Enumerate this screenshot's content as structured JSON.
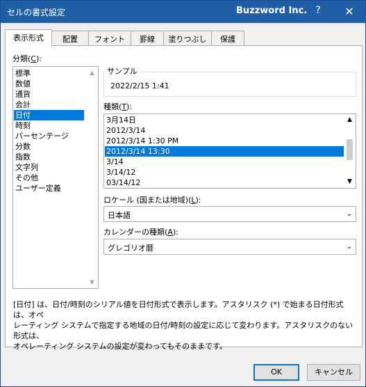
{
  "window": {
    "title": "セルの書式設定",
    "app_name": "Buzzword Inc.",
    "help_label": "?",
    "close_label": "✕"
  },
  "tabs": [
    {
      "label": "表示形式",
      "active": true
    },
    {
      "label": "配置"
    },
    {
      "label": "フォント"
    },
    {
      "label": "罫線"
    },
    {
      "label": "塗りつぶし"
    },
    {
      "label": "保護"
    }
  ],
  "category": {
    "label": "分類(",
    "accesskey": "C",
    "label_end": "):",
    "items": [
      "標準",
      "数値",
      "通貨",
      "会計",
      "日付",
      "時刻",
      "パーセンテージ",
      "分数",
      "指数",
      "文字列",
      "その他",
      "ユーザー定義"
    ],
    "selected_index": 4
  },
  "sample": {
    "title": "サンプル",
    "value": "2022/2/15 1:41"
  },
  "type": {
    "label": "種類(",
    "accesskey": "T",
    "label_end": "):",
    "items": [
      "3月14日",
      "2012/3/14",
      "2012/3/14 1:30 PM",
      "2012/3/14 13:30",
      "3/14",
      "3/14/12",
      "03/14/12"
    ],
    "selected_index": 3
  },
  "locale": {
    "label": "ロケール (国または地域)(",
    "accesskey": "L",
    "label_end": "):",
    "value": "日本語"
  },
  "calendar": {
    "label": "カレンダーの種類(",
    "accesskey": "A",
    "label_end": "):",
    "value": "グレゴリオ暦"
  },
  "description": {
    "line1": "[日付] は、日付/時刻のシリアル値を日付形式で表示します。アスタリスク (*) で始まる日付形式は、オペ",
    "line2": "レーティング システムで指定する地域の日付/時刻の設定に応じて変わります。アスタリスクのない形式は、",
    "line3": "オペレーティング システムの設定が変わってもそのままです。"
  },
  "buttons": {
    "ok": "OK",
    "cancel": "キャンセル"
  },
  "icons": {
    "scroll_up": "▲",
    "scroll_down": "▼",
    "dropdown": "⌄"
  }
}
